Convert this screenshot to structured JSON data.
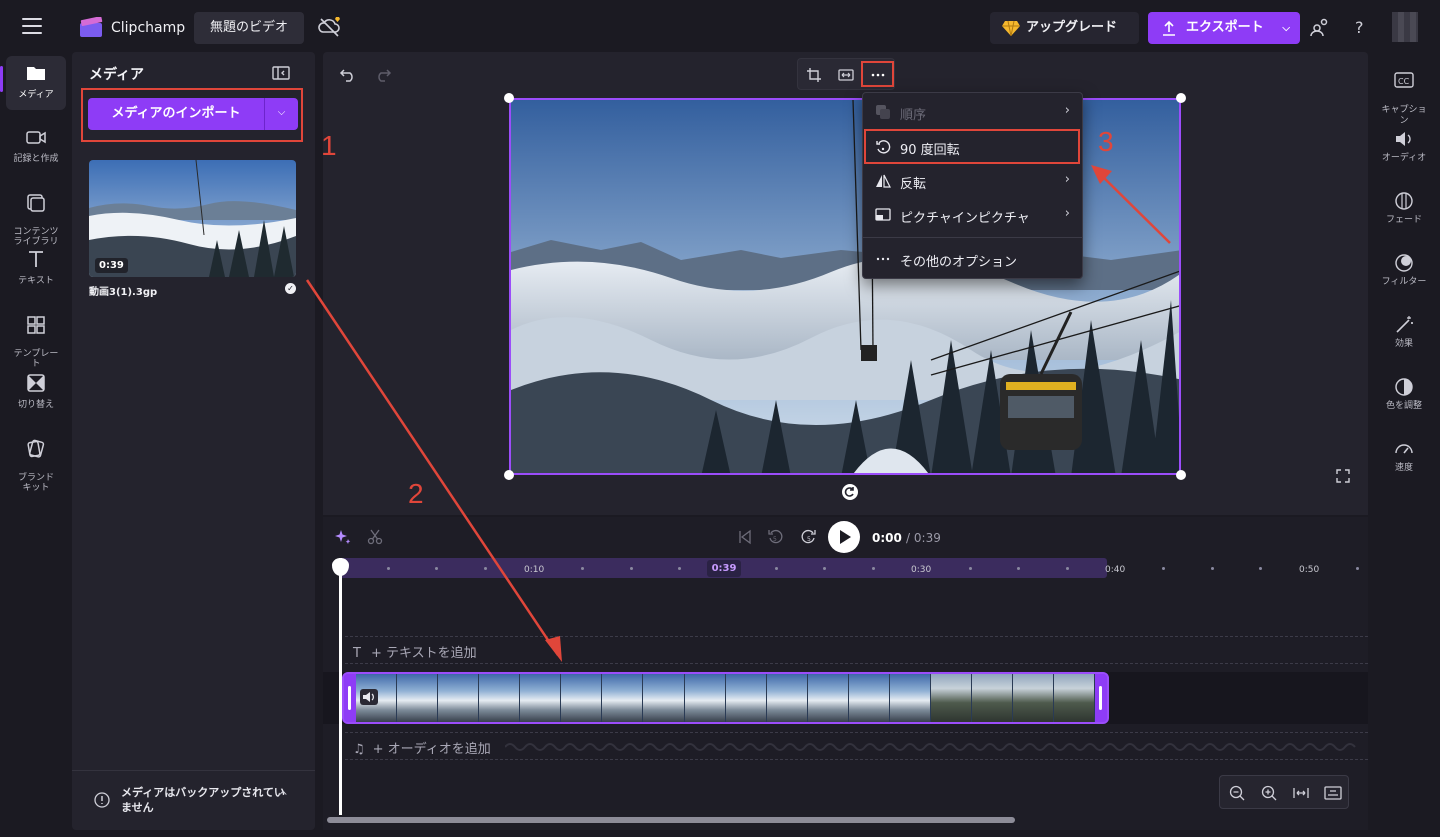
{
  "app": {
    "brand": "Clipchamp",
    "project_title": "無題のビデオ",
    "upgrade_label": "アップグレード",
    "export_label": "エクスポート",
    "accent": "#8e3cf6"
  },
  "left_rail": {
    "items": [
      {
        "label": "メディア",
        "icon": "folder-icon",
        "active": true
      },
      {
        "label": "記録と作成",
        "icon": "camera-icon"
      },
      {
        "label": "コンテンツ\nライブラリ",
        "icon": "library-icon"
      },
      {
        "label": "テキスト",
        "icon": "text-icon"
      },
      {
        "label": "テンプレー\nト",
        "icon": "templates-icon"
      },
      {
        "label": "切り替え",
        "icon": "transitions-icon"
      },
      {
        "label": "ブランド\nキット",
        "icon": "brand-kit-icon"
      }
    ]
  },
  "media_panel": {
    "title": "メディア",
    "import_label": "メディアのインポート",
    "file": {
      "duration": "0:39",
      "name": "動画3(1).3gp"
    },
    "backup_notice": "メディアはバックアップされていません"
  },
  "menu": {
    "items": [
      {
        "label": "順序",
        "icon": "layers-icon",
        "disabled": true,
        "submenu": true
      },
      {
        "label": "90 度回転",
        "icon": "rotate-icon",
        "submenu": false
      },
      {
        "label": "反転",
        "icon": "flip-icon",
        "submenu": true
      },
      {
        "label": "ピクチャインピクチャ",
        "icon": "pip-icon",
        "submenu": true
      },
      {
        "label": "その他のオプション",
        "icon": "more-icon",
        "submenu": false
      }
    ]
  },
  "annotations": [
    "1",
    "2",
    "3"
  ],
  "right_rail": {
    "items": [
      {
        "label": "キャプショ\nン",
        "icon": "captions-icon"
      },
      {
        "label": "オーディオ",
        "icon": "audio-icon"
      },
      {
        "label": "フェード",
        "icon": "fade-icon"
      },
      {
        "label": "フィルター",
        "icon": "filter-icon"
      },
      {
        "label": "効果",
        "icon": "effects-icon"
      },
      {
        "label": "色を調整",
        "icon": "color-icon"
      },
      {
        "label": "速度",
        "icon": "speed-icon"
      }
    ]
  },
  "timeline": {
    "current_time": "0:00",
    "total_time": "/ 0:39",
    "ticks": [
      "0:10",
      "0:30",
      "0:40",
      "0:50"
    ],
    "clip_end_badge": "0:39",
    "text_track": "+ テキストを追加",
    "audio_track": "+ オーディオを追加"
  }
}
